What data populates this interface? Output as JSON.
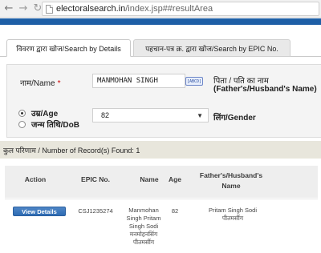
{
  "browser": {
    "url_host": "electoralsearch.in",
    "url_path": "/index.jsp##resultArea"
  },
  "tabs": [
    {
      "label": "विवरण द्वारा खोज/Search by Details",
      "active": true
    },
    {
      "label": "पहचान-पत्र क्र. द्वारा खोज/Search by EPIC No.",
      "active": false
    }
  ],
  "form": {
    "name_label": "नाम/Name",
    "required_mark": "*",
    "name_value": "MANMOHAN SINGH",
    "keyboard_label": "[ABCD]",
    "father_label_hi": "पिता / पति का नाम",
    "father_label_en": "(Father's/Husband's Name)",
    "age_label": "उम्र/Age",
    "dob_label": "जन्म तिथि/DoB",
    "age_value": "82",
    "gender_label": "लिंग/Gender",
    "age_selected": true
  },
  "results": {
    "count_text": "कुल परिणाम / Number of Record(s) Found: 1",
    "columns": [
      "Action",
      "EPIC No.",
      "Name",
      "Age",
      "Father's/Husband's Name"
    ],
    "rows": [
      {
        "action": "View Details",
        "epic": "CSJ1235274",
        "name_lines": [
          "Manmohan",
          "Singh Pritam",
          "Singh Sodi",
          "मनमोहनसिंग",
          "पीतमसींग"
        ],
        "age": "82",
        "father_lines": [
          "Pritam Singh Sodi",
          "पीतमसींग"
        ]
      }
    ]
  }
}
